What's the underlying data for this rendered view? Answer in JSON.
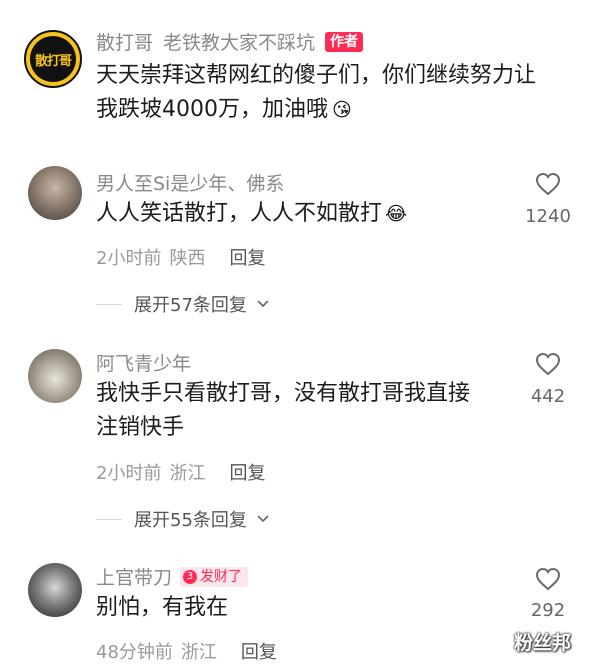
{
  "author_comment": {
    "username": "散打哥",
    "title": "老铁教大家不踩坑",
    "author_tag": "作者",
    "avatar_text": "散打哥",
    "text_line1": "天天崇拜这帮网红的傻子们，你们继续努力让",
    "text_line2": "我跌坡4000万，加油哦",
    "emoji": "😘"
  },
  "comments": [
    {
      "username": "男人至Si是少年、佛系",
      "text_line1": "人人笑话散打，人人不如散打",
      "text_line2": "",
      "emoji": "😂",
      "time": "2小时前",
      "location": "陕西",
      "reply_label": "回复",
      "likes": "1240",
      "expand_label": "展开57条回复"
    },
    {
      "username": "阿飞青少年",
      "text_line1": "我快手只看散打哥，没有散打哥我直接",
      "text_line2": "注销快手",
      "emoji": "",
      "time": "2小时前",
      "location": "浙江",
      "reply_label": "回复",
      "likes": "442",
      "expand_label": "展开55条回复"
    },
    {
      "username": "上官带刀",
      "badge_level": "3",
      "badge_text": "发财了",
      "text_line1": "别怕，有我在",
      "text_line2": "",
      "emoji": "",
      "time": "48分钟前",
      "location": "浙江",
      "reply_label": "回复",
      "likes": "292",
      "expand_label": ""
    }
  ],
  "watermark": "粉丝邦",
  "colors": {
    "accent": "#fe2c55",
    "badge_bg": "#fde5ec",
    "avatar_bg": "#f6c21c"
  }
}
